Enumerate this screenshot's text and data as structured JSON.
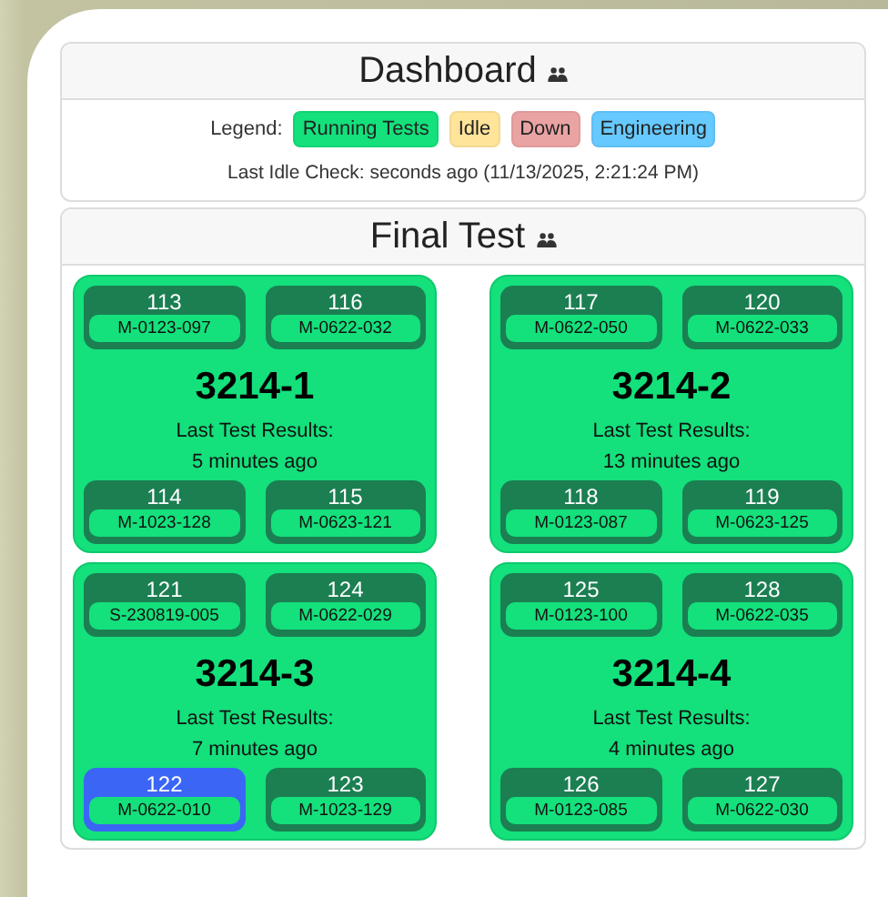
{
  "dashboard": {
    "title": "Dashboard",
    "legend_label": "Legend:",
    "legend": [
      {
        "label": "Running Tests",
        "color": "#14e07c"
      },
      {
        "label": "Idle",
        "color": "#ffe49a"
      },
      {
        "label": "Down",
        "color": "#eaa3a3"
      },
      {
        "label": "Engineering",
        "color": "#66c9ff"
      }
    ],
    "last_idle_check": "Last Idle Check: seconds ago (11/13/2025, 2:21:24 PM)"
  },
  "section": {
    "title": "Final Test",
    "stations": [
      {
        "name": "3214-1",
        "color": "#14e07c",
        "results_label": "Last Test Results:",
        "results_age": "5 minutes ago",
        "slots": [
          {
            "number": "113",
            "part": "M-0123-097",
            "color": "#1b7f52"
          },
          {
            "number": "116",
            "part": "M-0622-032",
            "color": "#1b7f52"
          },
          {
            "number": "114",
            "part": "M-1023-128",
            "color": "#1b7f52"
          },
          {
            "number": "115",
            "part": "M-0623-121",
            "color": "#1b7f52"
          }
        ]
      },
      {
        "name": "3214-2",
        "color": "#14e07c",
        "results_label": "Last Test Results:",
        "results_age": "13 minutes ago",
        "slots": [
          {
            "number": "117",
            "part": "M-0622-050",
            "color": "#1b7f52"
          },
          {
            "number": "120",
            "part": "M-0622-033",
            "color": "#1b7f52"
          },
          {
            "number": "118",
            "part": "M-0123-087",
            "color": "#1b7f52"
          },
          {
            "number": "119",
            "part": "M-0623-125",
            "color": "#1b7f52"
          }
        ]
      },
      {
        "name": "3214-3",
        "color": "#14e07c",
        "results_label": "Last Test Results:",
        "results_age": "7 minutes ago",
        "slots": [
          {
            "number": "121",
            "part": "S-230819-005",
            "color": "#1b7f52"
          },
          {
            "number": "124",
            "part": "M-0622-029",
            "color": "#1b7f52"
          },
          {
            "number": "122",
            "part": "M-0622-010",
            "color": "#3b66f5"
          },
          {
            "number": "123",
            "part": "M-1023-129",
            "color": "#1b7f52"
          }
        ]
      },
      {
        "name": "3214-4",
        "color": "#14e07c",
        "results_label": "Last Test Results:",
        "results_age": "4 minutes ago",
        "slots": [
          {
            "number": "125",
            "part": "M-0123-100",
            "color": "#1b7f52"
          },
          {
            "number": "128",
            "part": "M-0622-035",
            "color": "#1b7f52"
          },
          {
            "number": "126",
            "part": "M-0123-085",
            "color": "#1b7f52"
          },
          {
            "number": "127",
            "part": "M-0622-030",
            "color": "#1b7f52"
          }
        ]
      }
    ]
  }
}
